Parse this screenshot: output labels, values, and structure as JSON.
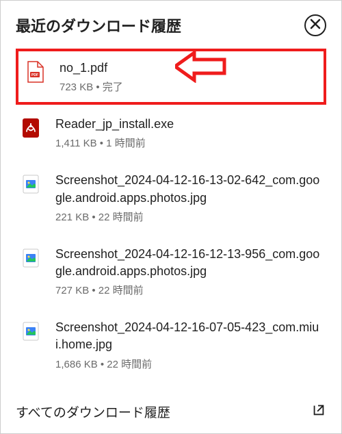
{
  "header": {
    "title": "最近のダウンロード履歴"
  },
  "items": [
    {
      "icon": "pdf-outline",
      "name": "no_1.pdf",
      "size": "723 KB",
      "status": "完了",
      "highlight": true
    },
    {
      "icon": "pdf-solid",
      "name": "Reader_jp_install.exe",
      "size": "1,411 KB",
      "status": "1 時間前",
      "highlight": false
    },
    {
      "icon": "image",
      "name": "Screenshot_2024-04-12-16-13-02-642_com.google.android.apps.photos.jpg",
      "size": "221 KB",
      "status": "22 時間前",
      "highlight": false
    },
    {
      "icon": "image",
      "name": "Screenshot_2024-04-12-16-12-13-956_com.google.android.apps.photos.jpg",
      "size": "727 KB",
      "status": "22 時間前",
      "highlight": false
    },
    {
      "icon": "image",
      "name": "Screenshot_2024-04-12-16-07-05-423_com.miui.home.jpg",
      "size": "1,686 KB",
      "status": "22 時間前",
      "highlight": false
    }
  ],
  "footer": {
    "text": "すべてのダウンロード履歴"
  },
  "annotation": {
    "arrow_color": "#ef1c1c"
  }
}
